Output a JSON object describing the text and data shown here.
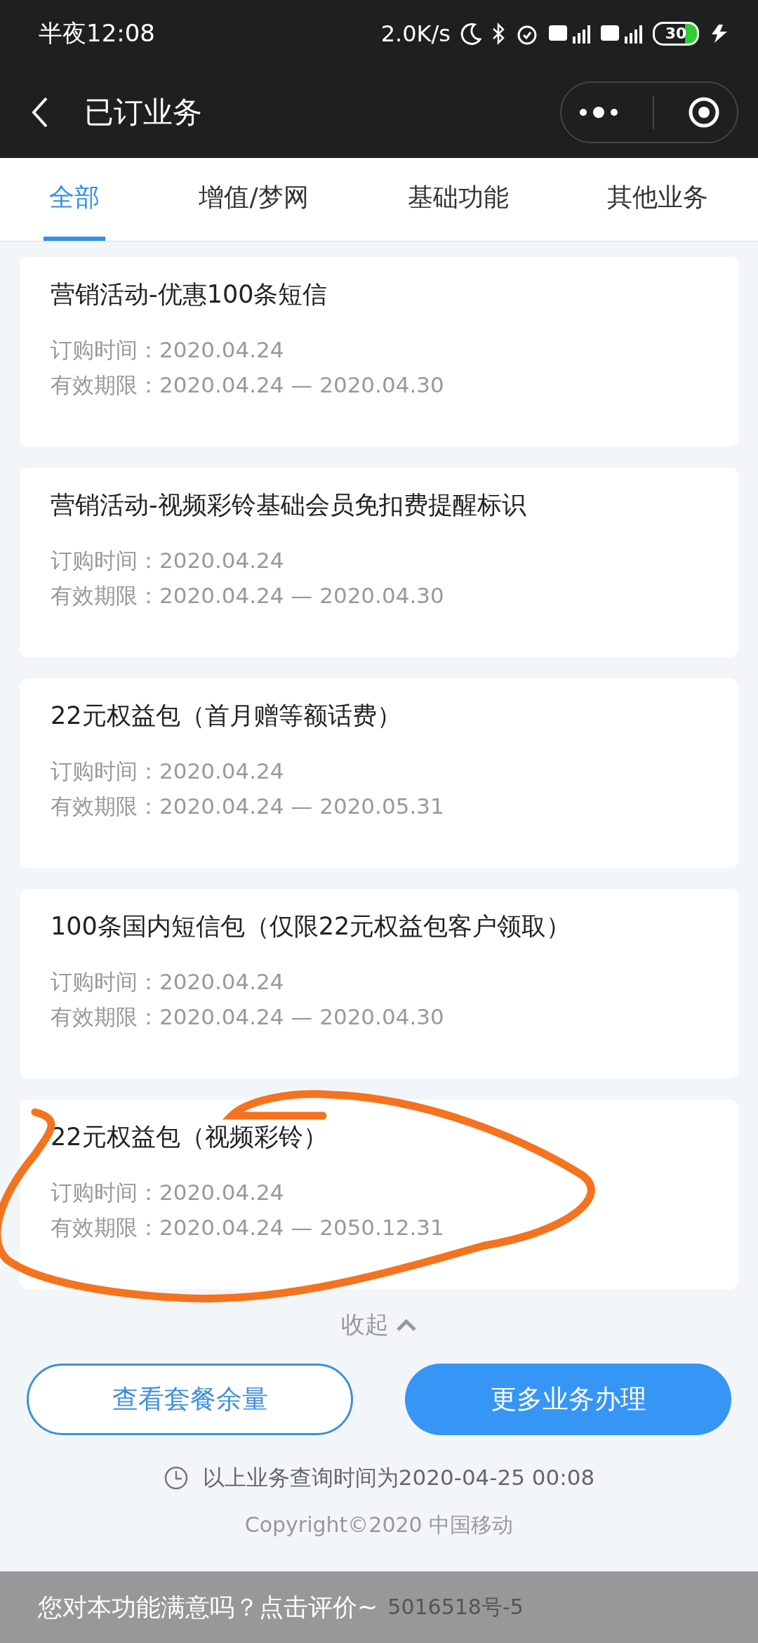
{
  "status_bar": {
    "time": "半夜12:08",
    "speed": "2.0K/s",
    "battery": "30"
  },
  "header": {
    "title": "已订业务"
  },
  "tabs": [
    {
      "label": "全部",
      "selected": true
    },
    {
      "label": "增值/梦网",
      "selected": false
    },
    {
      "label": "基础功能",
      "selected": false
    },
    {
      "label": "其他业务",
      "selected": false
    }
  ],
  "services": [
    {
      "name": "营销活动-优惠100条短信",
      "order_label": "订购时间：",
      "order_time": "2020.04.24",
      "valid_label": "有效期限：",
      "valid_period": "2020.04.24 — 2020.04.30"
    },
    {
      "name": "营销活动-视频彩铃基础会员免扣费提醒标识",
      "order_label": "订购时间：",
      "order_time": "2020.04.24",
      "valid_label": "有效期限：",
      "valid_period": "2020.04.24 — 2020.04.30"
    },
    {
      "name": "22元权益包（首月赠等额话费）",
      "order_label": "订购时间：",
      "order_time": "2020.04.24",
      "valid_label": "有效期限：",
      "valid_period": "2020.04.24 — 2020.05.31"
    },
    {
      "name": "100条国内短信包（仅限22元权益包客户领取）",
      "order_label": "订购时间：",
      "order_time": "2020.04.24",
      "valid_label": "有效期限：",
      "valid_period": "2020.04.24 — 2020.04.30"
    },
    {
      "name": "22元权益包（视频彩铃）",
      "order_label": "订购时间：",
      "order_time": "2020.04.24",
      "valid_label": "有效期限：",
      "valid_period": "2020.04.24 — 2050.12.31"
    }
  ],
  "collapse": {
    "label": "收起"
  },
  "buttons": [
    {
      "label": "查看套餐余量",
      "kind": "outline"
    },
    {
      "label": "更多业务办理",
      "kind": "filled"
    }
  ],
  "query_time": "以上业务查询时间为2020-04-25 00:08",
  "copyright": "Copyright©2020 中国移动",
  "icp_fragment": "5016518号-5",
  "feedback_toast": {
    "text": "您对本功能满意吗？点击评价~"
  }
}
